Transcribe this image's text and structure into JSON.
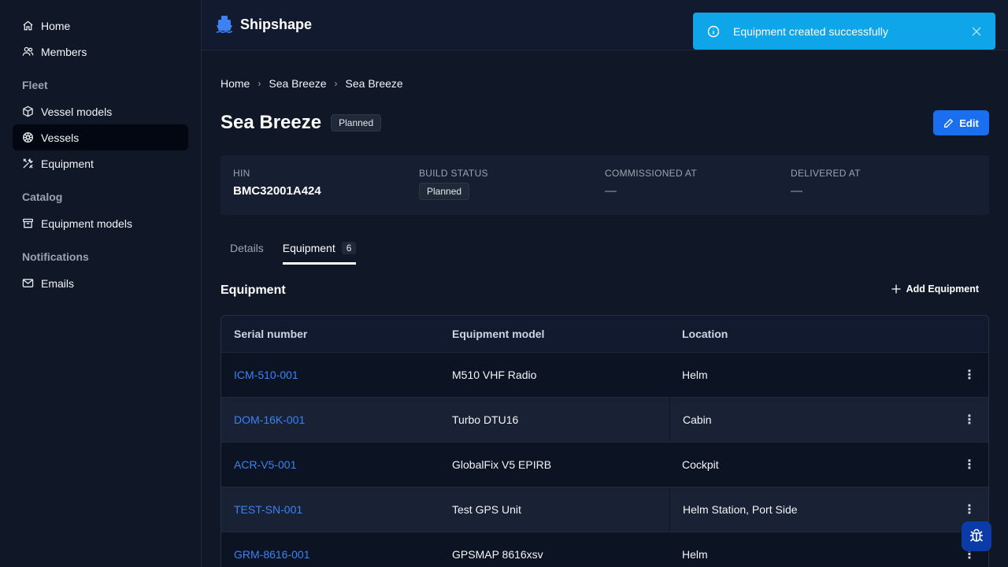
{
  "sidebar": {
    "items_top": [
      {
        "label": "Home",
        "icon": "home-icon"
      },
      {
        "label": "Members",
        "icon": "users-icon"
      }
    ],
    "sections": [
      {
        "title": "Fleet",
        "items": [
          {
            "label": "Vessel models",
            "icon": "cube-icon"
          },
          {
            "label": "Vessels",
            "icon": "helm-icon",
            "active": true
          },
          {
            "label": "Equipment",
            "icon": "tools-icon"
          }
        ]
      },
      {
        "title": "Catalog",
        "items": [
          {
            "label": "Equipment models",
            "icon": "archive-icon"
          }
        ]
      },
      {
        "title": "Notifications",
        "items": [
          {
            "label": "Emails",
            "icon": "mail-icon"
          }
        ]
      }
    ]
  },
  "header": {
    "app_name": "Shipshape",
    "logo_icon": "ship-icon"
  },
  "toast": {
    "message": "Equipment created successfully",
    "icon": "info-icon",
    "close_icon": "close-icon"
  },
  "breadcrumb": [
    "Home",
    "Sea Breeze",
    "Sea Breeze"
  ],
  "page": {
    "title": "Sea Breeze",
    "status_badge": "Planned",
    "edit_label": "Edit"
  },
  "summary": {
    "hin_label": "HIN",
    "hin_value": "BMC32001A424",
    "build_status_label": "BUILD STATUS",
    "build_status_value": "Planned",
    "commissioned_label": "COMMISSIONED AT",
    "commissioned_value": "—",
    "delivered_label": "DELIVERED AT",
    "delivered_value": "—"
  },
  "tabs": [
    {
      "label": "Details",
      "active": false
    },
    {
      "label": "Equipment",
      "count": "6",
      "active": true
    }
  ],
  "equipment": {
    "title": "Equipment",
    "add_label": "Add Equipment",
    "columns": [
      "Serial number",
      "Equipment model",
      "Location"
    ],
    "rows": [
      {
        "serial": "ICM-510-001",
        "model": "M510 VHF Radio",
        "location": "Helm"
      },
      {
        "serial": "DOM-16K-001",
        "model": "Turbo DTU16",
        "location": "Cabin"
      },
      {
        "serial": "ACR-V5-001",
        "model": "GlobalFix V5 EPIRB",
        "location": "Cockpit"
      },
      {
        "serial": "TEST-SN-001",
        "model": "Test GPS Unit",
        "location": "Helm Station, Port Side"
      },
      {
        "serial": "GRM-8616-001",
        "model": "GPSMAP 8616xsv",
        "location": "Helm"
      }
    ]
  },
  "colors": {
    "accent": "#1a6ff0",
    "link": "#3b82f6",
    "toast": "#0ea5e9",
    "background": "#101828"
  }
}
